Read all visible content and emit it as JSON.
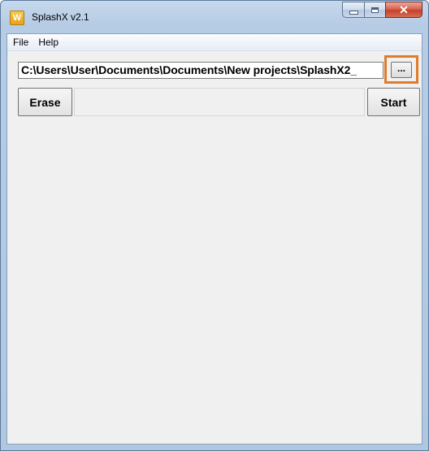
{
  "window": {
    "title": "SplashX v2.1",
    "app_icon_letter": "W",
    "app_icon": "splashx-app-icon",
    "caption_buttons": {
      "minimize_icon": "minimize-icon",
      "maximize_icon": "maximize-icon",
      "close_icon": "close-icon",
      "close_glyph": "✕"
    }
  },
  "menu": {
    "items": [
      {
        "label": "File"
      },
      {
        "label": "Help"
      }
    ]
  },
  "main": {
    "path_value": "C:\\Users\\User\\Documents\\Documents\\New projects\\SplashX2_",
    "browse_label": "...",
    "erase_label": "Erase",
    "start_label": "Start",
    "status_text": ""
  },
  "colors": {
    "highlight": "#e07b2c",
    "client_bg": "#f0f0f0",
    "window_frame": "#b6cce4",
    "close_red": "#c7402a"
  }
}
